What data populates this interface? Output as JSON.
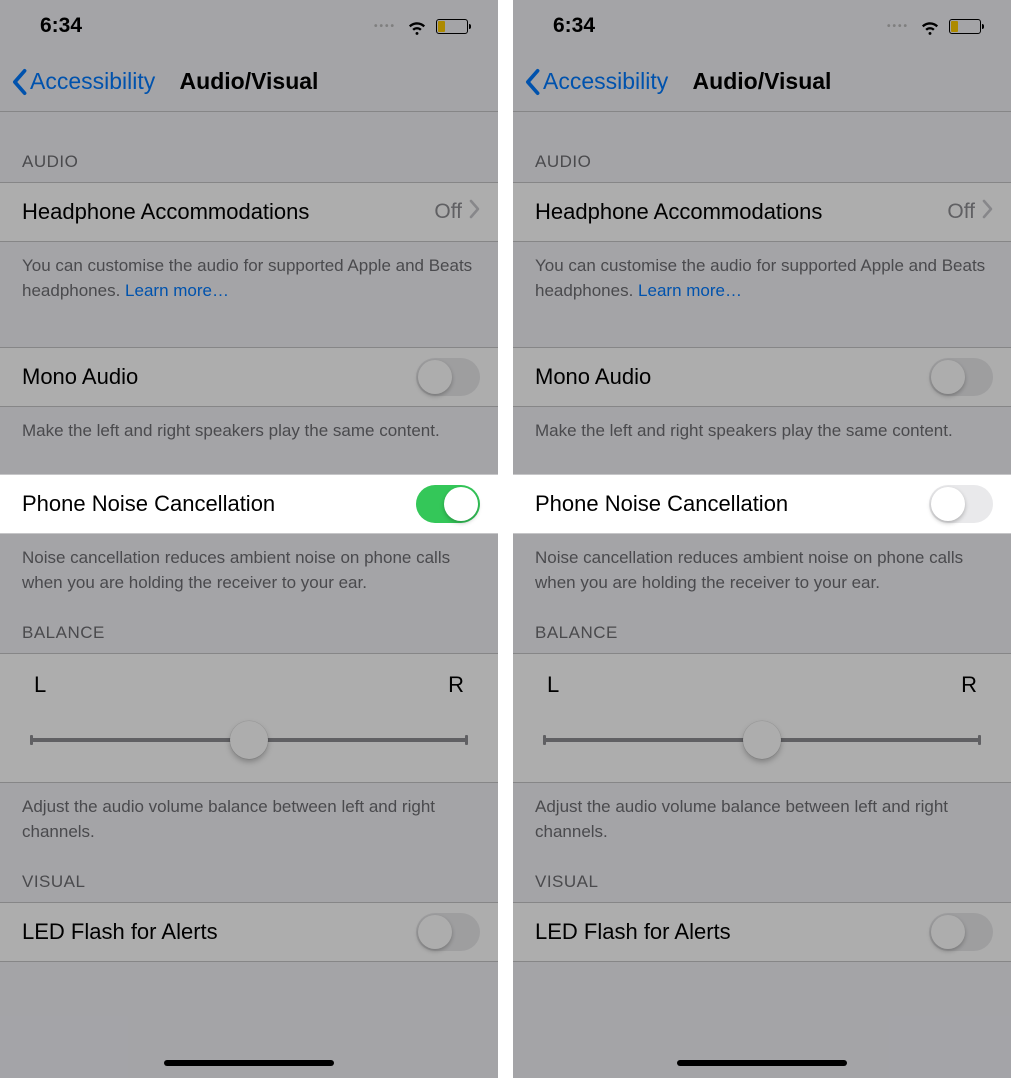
{
  "statusBar": {
    "time": "6:34"
  },
  "nav": {
    "back": "Accessibility",
    "title": "Audio/Visual"
  },
  "sections": {
    "audio_header": "Audio",
    "headphone": {
      "label": "Headphone Accommodations",
      "value": "Off"
    },
    "headphone_footer": "You can customise the audio for supported Apple and Beats headphones. ",
    "learn_more": "Learn more…",
    "mono": {
      "label": "Mono Audio"
    },
    "mono_footer": "Make the left and right speakers play the same content.",
    "noise": {
      "label": "Phone Noise Cancellation"
    },
    "noise_footer": "Noise cancellation reduces ambient noise on phone calls when you are holding the receiver to your ear.",
    "balance_header": "Balance",
    "balance": {
      "left": "L",
      "right": "R"
    },
    "balance_footer": "Adjust the audio volume balance between left and right channels.",
    "visual_header": "Visual",
    "led": {
      "label": "LED Flash for Alerts"
    }
  },
  "left_panel": {
    "noise_on": true
  },
  "right_panel": {
    "noise_on": false
  }
}
